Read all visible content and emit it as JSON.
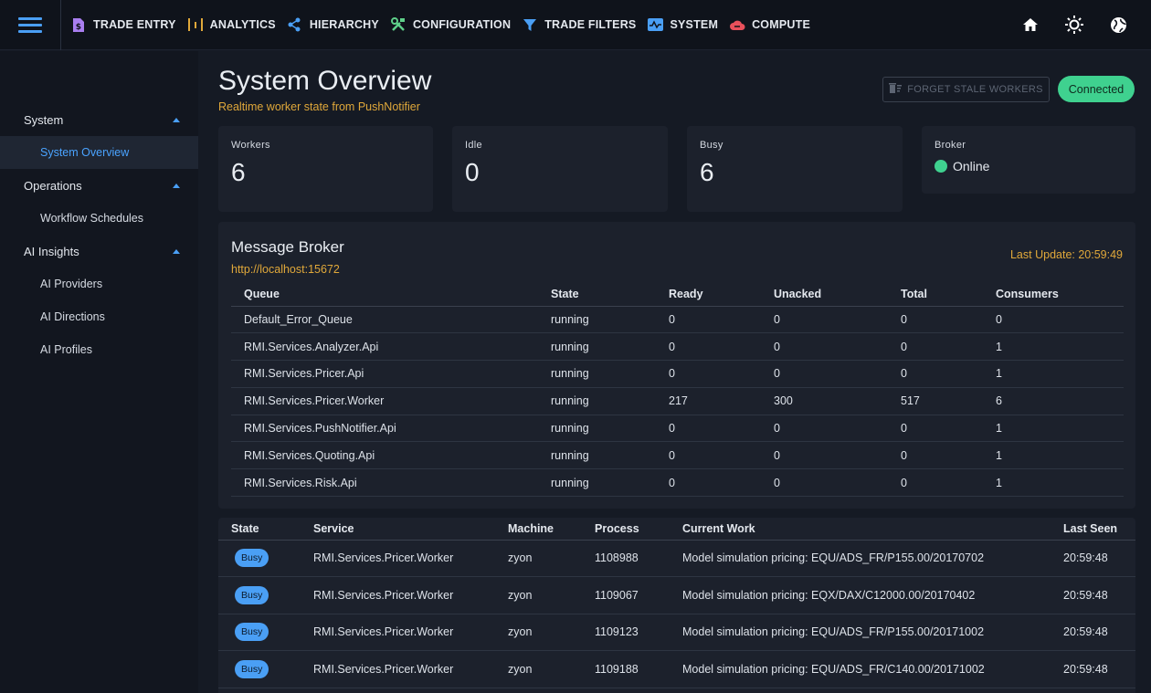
{
  "nav": {
    "items": [
      {
        "label": "TRADE ENTRY",
        "icon": "document-dollar-icon"
      },
      {
        "label": "ANALYTICS",
        "icon": "analytics-bars-icon"
      },
      {
        "label": "HIERARCHY",
        "icon": "hierarchy-icon"
      },
      {
        "label": "CONFIGURATION",
        "icon": "tools-icon"
      },
      {
        "label": "TRADE FILTERS",
        "icon": "filter-icon"
      },
      {
        "label": "SYSTEM",
        "icon": "system-monitor-icon"
      },
      {
        "label": "COMPUTE",
        "icon": "compute-icon"
      }
    ]
  },
  "sidebar": {
    "groups": [
      {
        "label": "System",
        "items": [
          {
            "label": "System Overview"
          }
        ]
      },
      {
        "label": "Operations",
        "items": [
          {
            "label": "Workflow Schedules"
          }
        ]
      },
      {
        "label": "AI Insights",
        "items": [
          {
            "label": "AI Providers"
          },
          {
            "label": "AI Directions"
          },
          {
            "label": "AI Profiles"
          }
        ]
      }
    ]
  },
  "header": {
    "title": "System Overview",
    "subtitle": "Realtime worker state from PushNotifier",
    "forget_label": "FORGET STALE WORKERS",
    "status_label": "Connected"
  },
  "stats": {
    "workers": {
      "label": "Workers",
      "value": "6"
    },
    "idle": {
      "label": "Idle",
      "value": "0"
    },
    "busy": {
      "label": "Busy",
      "value": "6"
    },
    "broker": {
      "label": "Broker",
      "value": "Online"
    }
  },
  "broker": {
    "title": "Message Broker",
    "url": "http://localhost:15672",
    "last_update": "Last Update: 20:59:49",
    "columns": [
      "Queue",
      "State",
      "Ready",
      "Unacked",
      "Total",
      "Consumers"
    ],
    "rows": [
      [
        "Default_Error_Queue",
        "running",
        "0",
        "0",
        "0",
        "0"
      ],
      [
        "RMI.Services.Analyzer.Api",
        "running",
        "0",
        "0",
        "0",
        "1"
      ],
      [
        "RMI.Services.Pricer.Api",
        "running",
        "0",
        "0",
        "0",
        "1"
      ],
      [
        "RMI.Services.Pricer.Worker",
        "running",
        "217",
        "300",
        "517",
        "6"
      ],
      [
        "RMI.Services.PushNotifier.Api",
        "running",
        "0",
        "0",
        "0",
        "1"
      ],
      [
        "RMI.Services.Quoting.Api",
        "running",
        "0",
        "0",
        "0",
        "1"
      ],
      [
        "RMI.Services.Risk.Api",
        "running",
        "0",
        "0",
        "0",
        "1"
      ]
    ]
  },
  "workers": {
    "columns": [
      "State",
      "Service",
      "Machine",
      "Process",
      "Current Work",
      "Last Seen"
    ],
    "rows": [
      [
        "Busy",
        "RMI.Services.Pricer.Worker",
        "zyon",
        "1108988",
        "Model simulation pricing: EQU/ADS_FR/P155.00/20170702",
        "20:59:48"
      ],
      [
        "Busy",
        "RMI.Services.Pricer.Worker",
        "zyon",
        "1109067",
        "Model simulation pricing: EQX/DAX/C12000.00/20170402",
        "20:59:48"
      ],
      [
        "Busy",
        "RMI.Services.Pricer.Worker",
        "zyon",
        "1109123",
        "Model simulation pricing: EQU/ADS_FR/P155.00/20171002",
        "20:59:48"
      ],
      [
        "Busy",
        "RMI.Services.Pricer.Worker",
        "zyon",
        "1109188",
        "Model simulation pricing: EQU/ADS_FR/C140.00/20171002",
        "20:59:48"
      ]
    ]
  },
  "colors": {
    "accent": "#4a9ff5",
    "warning_text": "#e0a83a",
    "success": "#3fd18f",
    "background": "#151a24",
    "card": "#1c212c"
  }
}
